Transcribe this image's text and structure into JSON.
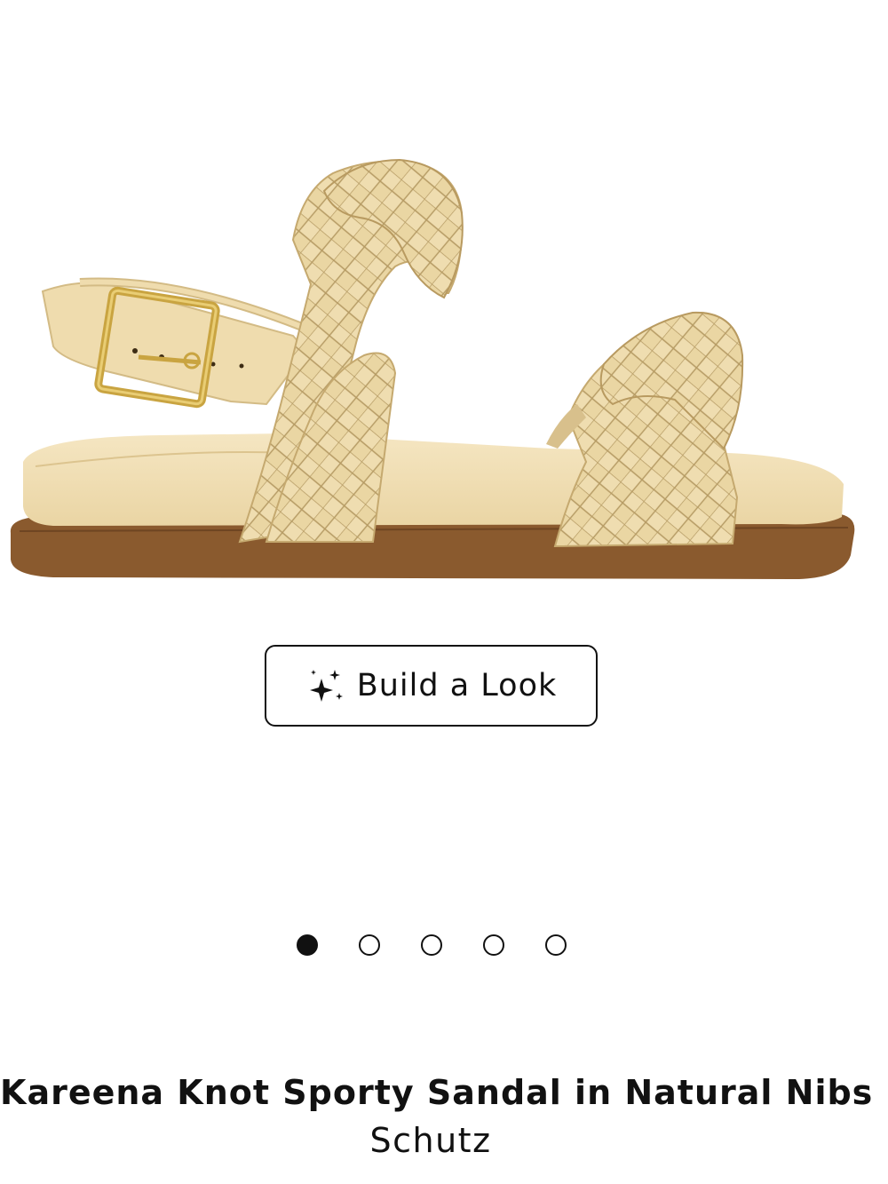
{
  "product": {
    "image_alt": "Kareena Knot Sporty Sandal in Natural Nibs",
    "title": "Kareena Knot Sporty Sandal in Natural Nibs",
    "brand": "Schutz"
  },
  "build_look": {
    "label": "Build a Look",
    "icon": "sparkle-icon"
  },
  "carousel": {
    "total_slides": 5,
    "active_slide": 1
  },
  "colors": {
    "text": "#111111",
    "background": "#ffffff",
    "sandal_leather": "#eedcaa",
    "sandal_sole": "#8a5a2e",
    "buckle_gold": "#c9a441"
  }
}
